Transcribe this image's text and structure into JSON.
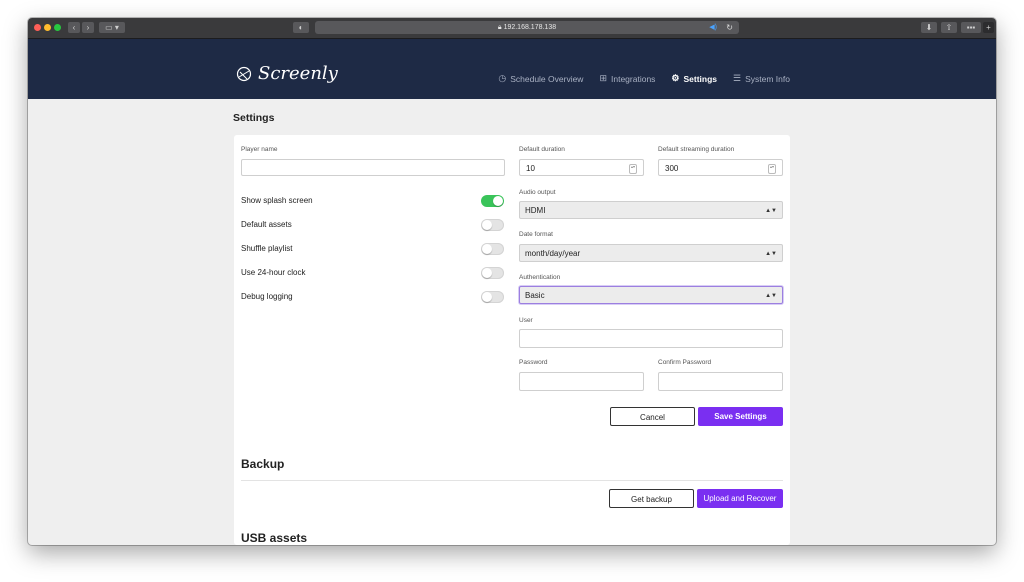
{
  "browser": {
    "url": "192.168.178.138"
  },
  "brand": {
    "name": "Screenly"
  },
  "nav": {
    "items": [
      {
        "label": "Schedule Overview",
        "icon": "clock-icon"
      },
      {
        "label": "Integrations",
        "icon": "plus-square-icon"
      },
      {
        "label": "Settings",
        "icon": "gears-icon",
        "active": true
      },
      {
        "label": "System Info",
        "icon": "list-icon"
      }
    ]
  },
  "page": {
    "title": "Settings"
  },
  "settings": {
    "player_name": {
      "label": "Player name",
      "value": ""
    },
    "default_duration": {
      "label": "Default duration",
      "value": "10"
    },
    "default_streaming_duration": {
      "label": "Default streaming duration",
      "value": "300"
    },
    "audio_output": {
      "label": "Audio output",
      "value": "HDMI"
    },
    "date_format": {
      "label": "Date format",
      "value": "month/day/year"
    },
    "authentication": {
      "label": "Authentication",
      "value": "Basic"
    },
    "user": {
      "label": "User",
      "value": ""
    },
    "password": {
      "label": "Password",
      "value": ""
    },
    "confirm_password": {
      "label": "Confirm Password",
      "value": ""
    },
    "toggles": [
      {
        "label": "Show splash screen",
        "on": true
      },
      {
        "label": "Default assets",
        "on": false
      },
      {
        "label": "Shuffle playlist",
        "on": false
      },
      {
        "label": "Use 24-hour clock",
        "on": false
      },
      {
        "label": "Debug logging",
        "on": false
      }
    ],
    "cancel_label": "Cancel",
    "save_label": "Save Settings"
  },
  "backup": {
    "title": "Backup",
    "get_label": "Get backup",
    "upload_label": "Upload and Recover"
  },
  "usb": {
    "title": "USB assets"
  },
  "colors": {
    "navbar": "#1e2a45",
    "accent": "#7a2ff1",
    "toggle_on": "#3ac45a"
  }
}
